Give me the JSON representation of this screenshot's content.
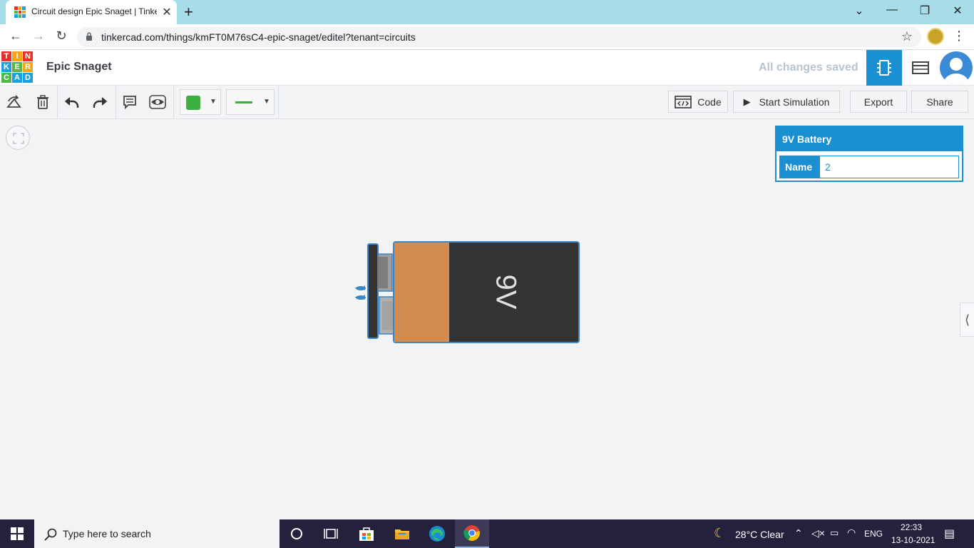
{
  "browser": {
    "tab_title": "Circuit design Epic Snaget | Tinkercad",
    "url": "tinkercad.com/things/kmFT0M76sC4-epic-snaget/editel?tenant=circuits"
  },
  "header": {
    "logo_letters": [
      "T",
      "I",
      "N",
      "K",
      "E",
      "R",
      "C",
      "A",
      "D"
    ],
    "project_name": "Epic Snaget",
    "save_status": "All changes saved"
  },
  "toolbar": {
    "code_label": "Code",
    "simulate_label": "Start Simulation",
    "export_label": "Export",
    "share_label": "Share",
    "color_swatch": "#3cb043",
    "wire_color": "#3cb043"
  },
  "canvas": {
    "component": {
      "label": "9V",
      "type": "9V Battery"
    }
  },
  "inspector": {
    "title": "9V Battery",
    "name_label": "Name",
    "name_value": "2"
  },
  "taskbar": {
    "search_placeholder": "Type here to search",
    "weather": "28°C  Clear",
    "language": "ENG",
    "time": "22:33",
    "date": "13-10-2021"
  },
  "colors": {
    "accent": "#1a8fd1",
    "battery_body": "#333333",
    "battery_band": "#d38b4f",
    "taskbar": "#24213c"
  }
}
